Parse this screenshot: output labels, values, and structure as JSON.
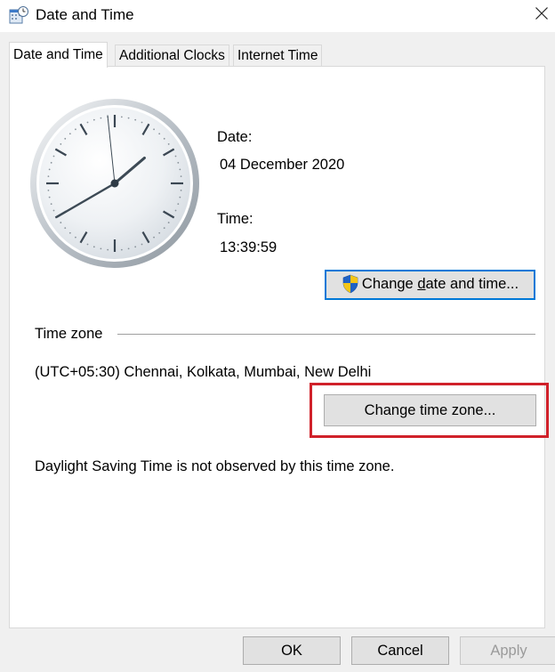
{
  "window": {
    "title": "Date and Time",
    "close_label": "Close"
  },
  "tabs": [
    {
      "label": "Date and Time",
      "active": true
    },
    {
      "label": "Additional Clocks",
      "active": false
    },
    {
      "label": "Internet Time",
      "active": false
    }
  ],
  "clock": {
    "time": "13:39:59"
  },
  "date_section": {
    "date_label": "Date:",
    "date_value": "04 December 2020",
    "time_label": "Time:",
    "time_value": "13:39:59",
    "change_button": {
      "before": "Change ",
      "accelerator": "d",
      "after": "ate and time...",
      "icon": "uac-shield-icon"
    }
  },
  "timezone": {
    "heading": "Time zone",
    "value": "(UTC+05:30) Chennai, Kolkata, Mumbai, New Delhi",
    "change_button": "Change time zone...",
    "dst_note": "Daylight Saving Time is not observed by this time zone."
  },
  "footer": {
    "ok": "OK",
    "cancel": "Cancel",
    "apply": "Apply"
  },
  "colors": {
    "highlight": "#d0212a",
    "focus": "#0078d7"
  }
}
